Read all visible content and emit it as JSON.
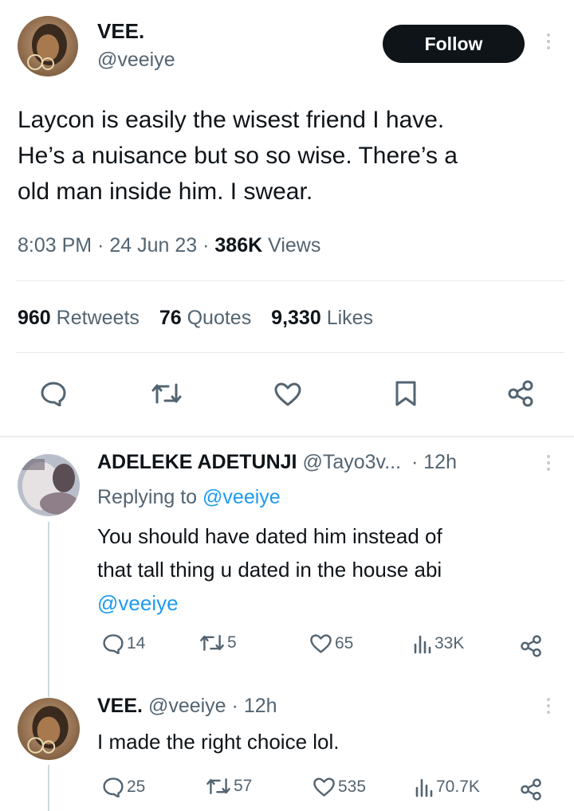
{
  "tweet": {
    "author_name": "VEE.",
    "author_handle": "@veeiye",
    "follow_label": "Follow",
    "text_lines": [
      "Laycon is easily the wisest friend I have.",
      "He’s a nuisance but so so wise. There’s a",
      "old man inside him. I swear."
    ],
    "time": "8:03 PM",
    "sep": "·",
    "date": "24 Jun 23",
    "views_count": "386K",
    "views_label": "Views",
    "retweets_count": "960",
    "retweets_label": "Retweets",
    "quotes_count": "76",
    "quotes_label": "Quotes",
    "likes_count": "9,330",
    "likes_label": "Likes"
  },
  "reply1": {
    "author_name": "ADELEKE ADETUNJI",
    "author_handle": "@Tayo3v...",
    "time": "· 12h",
    "replying_prefix": "Replying to",
    "replying_handle": "@veeiye",
    "text_lines": [
      "You should have dated him instead of",
      "that tall thing u dated in the house abi"
    ],
    "mention": "@veeiye",
    "replies": "14",
    "retweets": "5",
    "likes": "65",
    "views": "33K"
  },
  "reply2": {
    "author_name": "VEE.",
    "author_handle": "@veeiye",
    "time": "· 12h",
    "text": "I made the right choice lol.",
    "replies": "25",
    "retweets": "57",
    "likes": "535",
    "views": "70.7K"
  },
  "icons": {
    "reply": "reply-icon",
    "retweet": "retweet-icon",
    "like": "heart-icon",
    "bookmark": "bookmark-icon",
    "share": "share-icon",
    "views": "views-icon",
    "more": "more-icon"
  },
  "colors": {
    "text": "#0f1419",
    "secondary": "#536471",
    "link": "#1d9bf0",
    "follow_bg": "#0f1419"
  }
}
